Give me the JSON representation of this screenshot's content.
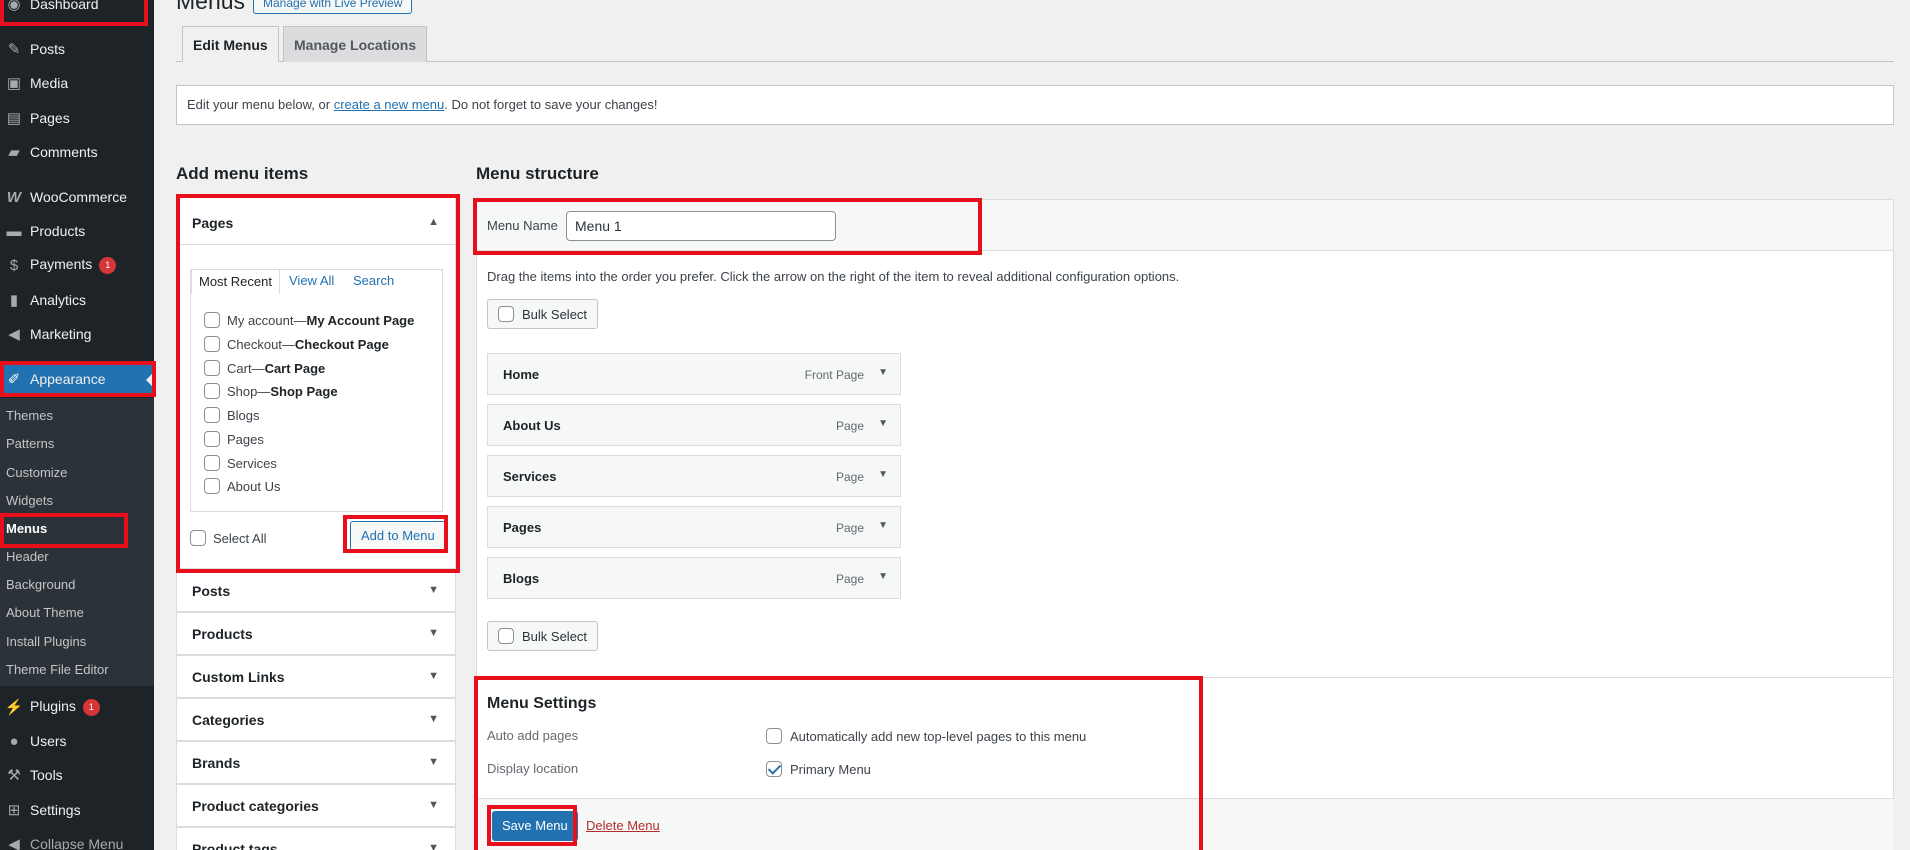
{
  "sidebar": {
    "items": [
      {
        "label": "Dashboard",
        "icon": "dashboard-icon"
      },
      {
        "label": "Posts",
        "icon": "pin-icon"
      },
      {
        "label": "Media",
        "icon": "media-icon"
      },
      {
        "label": "Pages",
        "icon": "pages-icon"
      },
      {
        "label": "Comments",
        "icon": "comment-icon"
      },
      {
        "label": "WooCommerce",
        "icon": "woo-icon"
      },
      {
        "label": "Products",
        "icon": "archive-icon"
      },
      {
        "label": "Payments",
        "icon": "dollar-icon",
        "badge": "1"
      },
      {
        "label": "Analytics",
        "icon": "bar-chart-icon"
      },
      {
        "label": "Marketing",
        "icon": "megaphone-icon"
      },
      {
        "label": "Appearance",
        "icon": "brush-icon"
      },
      {
        "label": "Plugins",
        "icon": "plug-icon",
        "badge": "1"
      },
      {
        "label": "Users",
        "icon": "user-icon"
      },
      {
        "label": "Tools",
        "icon": "wrench-icon"
      },
      {
        "label": "Settings",
        "icon": "sliders-icon"
      },
      {
        "label": "Collapse Menu",
        "icon": "collapse-icon"
      }
    ],
    "appearance_sub": [
      "Themes",
      "Patterns",
      "Customize",
      "Widgets",
      "Menus",
      "Header",
      "Background",
      "About Theme",
      "Install Plugins",
      "Theme File Editor"
    ]
  },
  "header": {
    "title": "Menus",
    "live_preview": "Manage with Live Preview"
  },
  "tabs": [
    "Edit Menus",
    "Manage Locations"
  ],
  "notice": {
    "before": "Edit your menu below, or ",
    "link": "create a new menu",
    "after": ". Do not forget to save your changes!"
  },
  "add_items": {
    "heading": "Add menu items",
    "pages_title": "Pages",
    "page_tabs": [
      "Most Recent",
      "View All",
      "Search"
    ],
    "pages": [
      {
        "name": "My account",
        "suffix": "My Account Page"
      },
      {
        "name": "Checkout",
        "suffix": "Checkout Page"
      },
      {
        "name": "Cart",
        "suffix": "Cart Page"
      },
      {
        "name": "Shop",
        "suffix": "Shop Page"
      },
      {
        "name": "Blogs",
        "suffix": ""
      },
      {
        "name": "Pages",
        "suffix": ""
      },
      {
        "name": "Services",
        "suffix": ""
      },
      {
        "name": "About Us",
        "suffix": ""
      }
    ],
    "dash": " — ",
    "select_all": "Select All",
    "add_button": "Add to Menu",
    "sections": [
      "Posts",
      "Products",
      "Custom Links",
      "Categories",
      "Brands",
      "Product categories",
      "Product tags"
    ]
  },
  "structure": {
    "heading": "Menu structure",
    "name_label": "Menu Name",
    "name_value": "Menu 1",
    "hint": "Drag the items into the order you prefer. Click the arrow on the right of the item to reveal additional configuration options.",
    "bulk_select": "Bulk Select",
    "items": [
      {
        "title": "Home",
        "type": "Front Page"
      },
      {
        "title": "About Us",
        "type": "Page"
      },
      {
        "title": "Services",
        "type": "Page"
      },
      {
        "title": "Pages",
        "type": "Page"
      },
      {
        "title": "Blogs",
        "type": "Page"
      }
    ]
  },
  "settings": {
    "title": "Menu Settings",
    "auto_label": "Auto add pages",
    "auto_option": "Automatically add new top-level pages to this menu",
    "auto_checked": false,
    "location_label": "Display location",
    "location_option": "Primary Menu",
    "location_checked": true,
    "save": "Save Menu",
    "delete": "Delete Menu"
  },
  "colors": {
    "accent": "#2271b1",
    "highlight": "#e80f1c",
    "sidebar_bg": "#1d2327",
    "danger": "#b32d2e"
  }
}
